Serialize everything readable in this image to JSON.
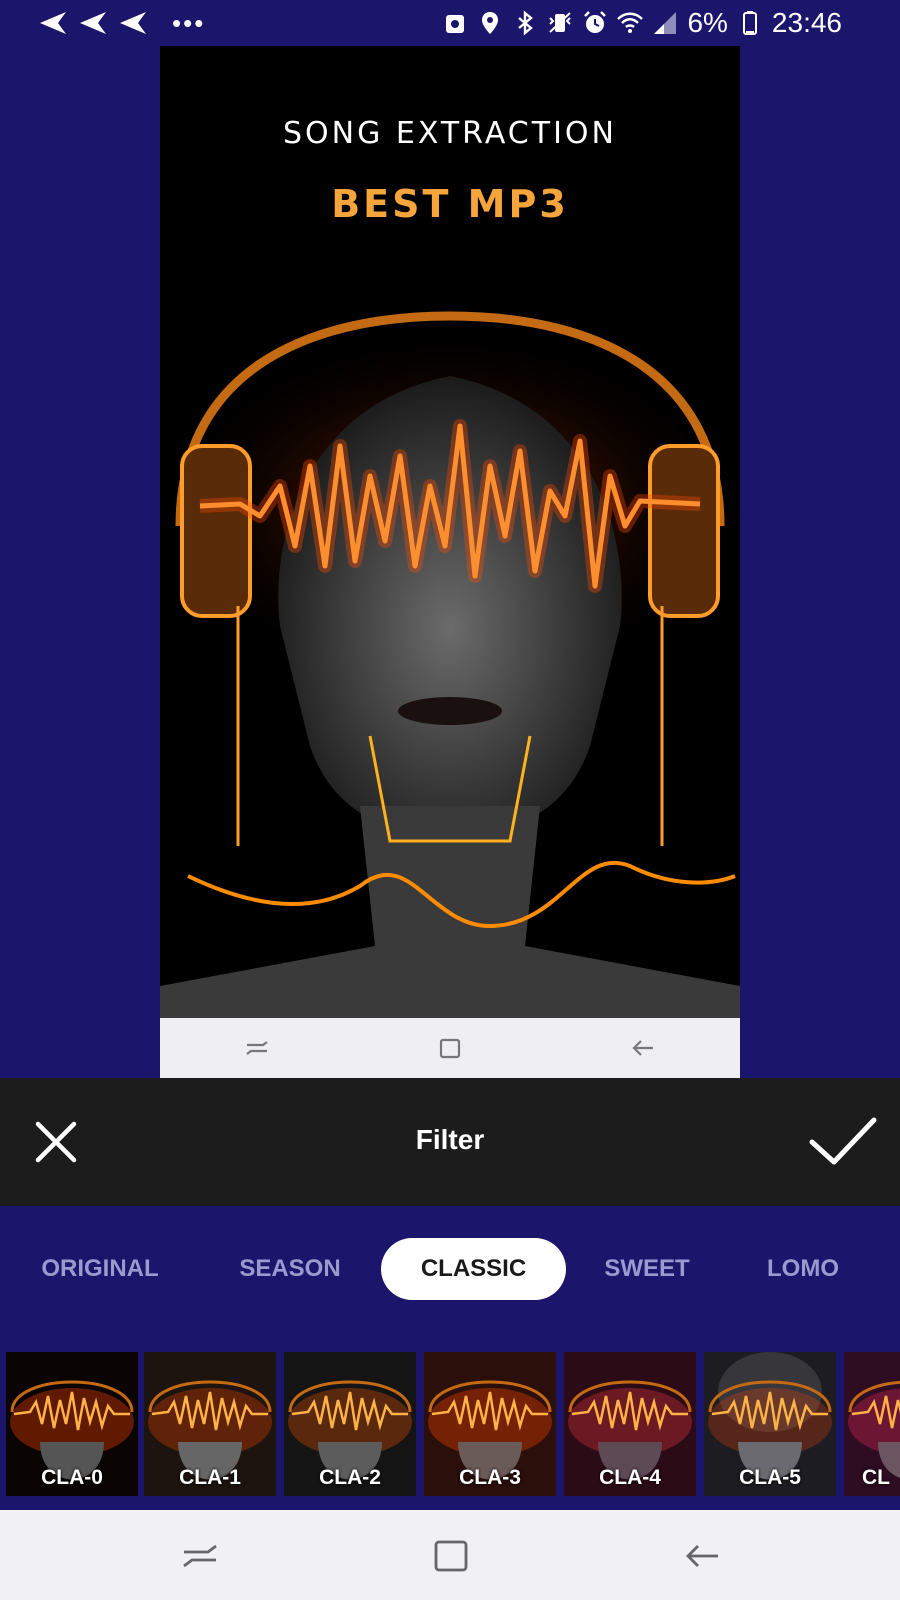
{
  "status_bar": {
    "battery": "6%",
    "time": "23:46",
    "dots": "•••",
    "icons_left": [
      "send-icon",
      "send-icon",
      "send-icon",
      "more-dots-icon"
    ],
    "icons_right": [
      "location-icon",
      "bluetooth-icon",
      "vibrate-icon",
      "alarm-icon",
      "wifi-icon",
      "signal-icon",
      "battery-icon"
    ]
  },
  "preview": {
    "poster_title": "SONG EXTRACTION",
    "poster_subtitle": "BEST MP3"
  },
  "toolbar": {
    "title": "Filter",
    "close_icon": "close-icon",
    "confirm_icon": "check-icon"
  },
  "tabs": [
    {
      "label": "ORIGINAL",
      "active": false
    },
    {
      "label": "SEASON",
      "active": false
    },
    {
      "label": "CLASSIC",
      "active": true
    },
    {
      "label": "SWEET",
      "active": false
    },
    {
      "label": "LOMO",
      "active": false
    }
  ],
  "filters": [
    {
      "label": "CLA-0"
    },
    {
      "label": "CLA-1"
    },
    {
      "label": "CLA-2"
    },
    {
      "label": "CLA-3"
    },
    {
      "label": "CLA-4"
    },
    {
      "label": "CLA-5"
    },
    {
      "label": "CL"
    }
  ],
  "colors": {
    "background": "#1c156c",
    "toolbar": "#1c1c1c",
    "accent_glow": "#ff7a1a",
    "tab_inactive": "#9a9ace"
  }
}
